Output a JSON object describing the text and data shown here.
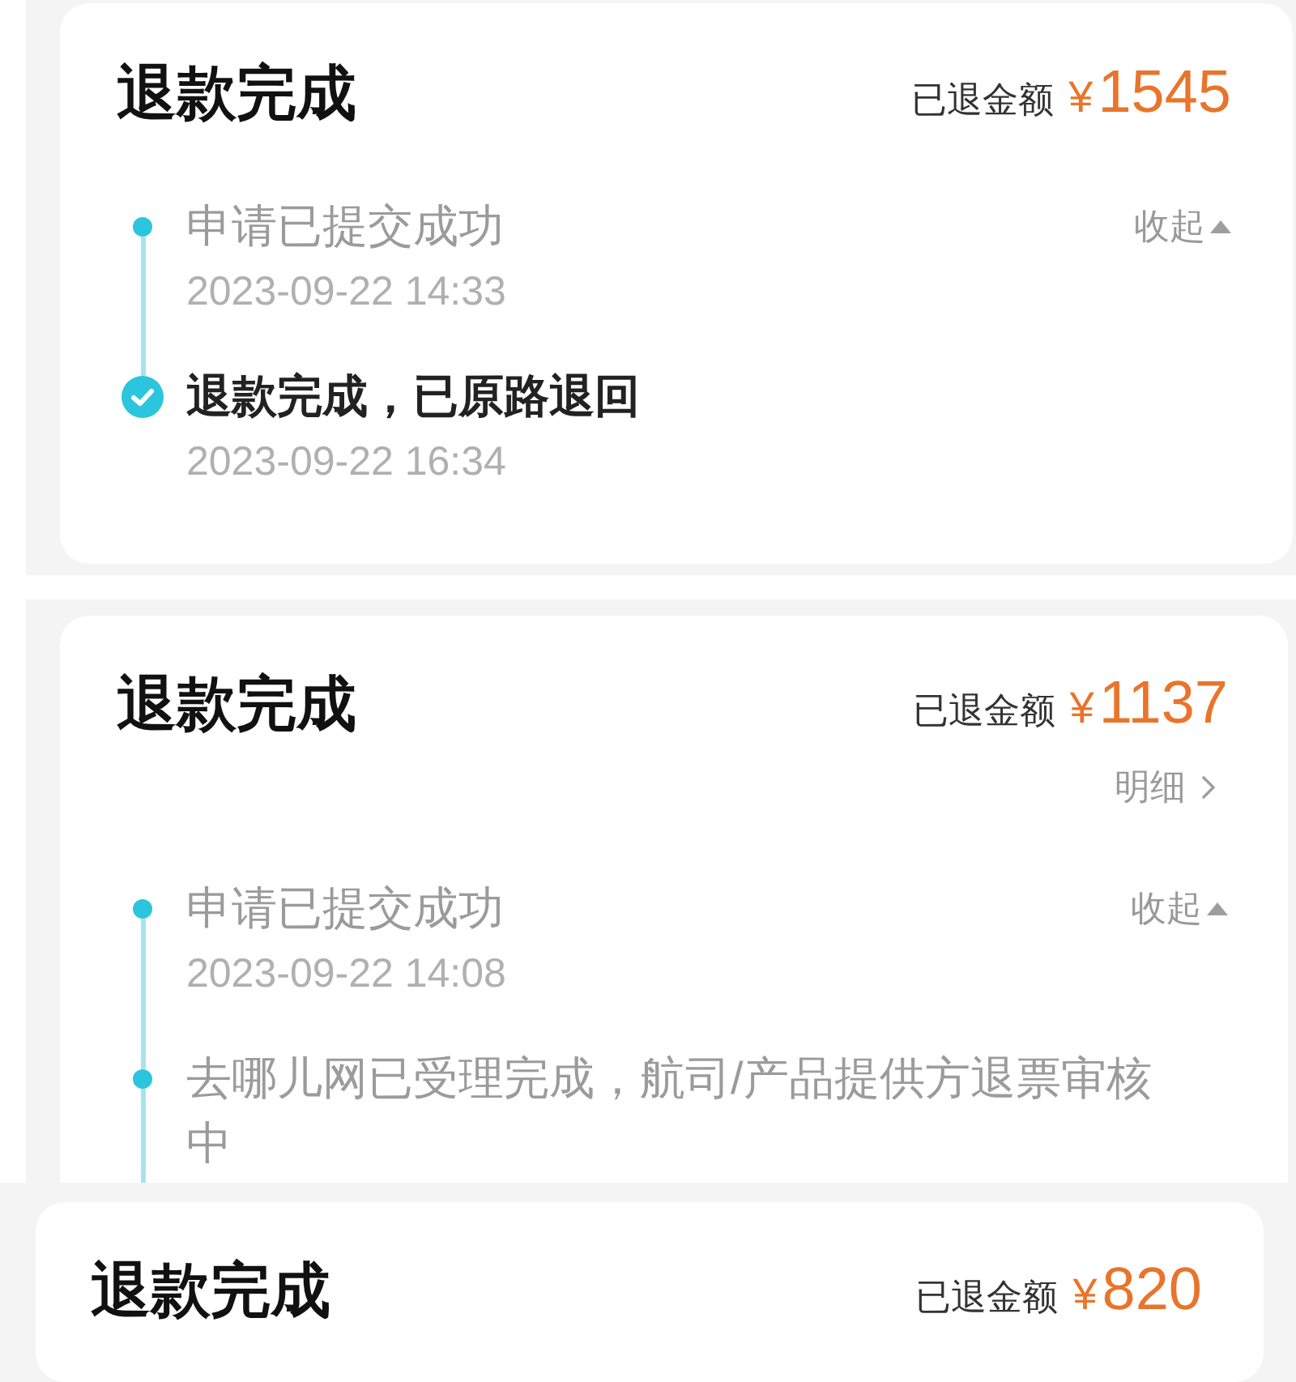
{
  "cards": [
    {
      "title": "退款完成",
      "amount_label": "已退金额",
      "currency": "¥",
      "amount": "1545",
      "collapse_label": "收起",
      "timeline": [
        {
          "kind": "dot",
          "text": "申请已提交成功",
          "time": "2023-09-22 14:33"
        },
        {
          "kind": "check",
          "text": "退款完成，已原路退回",
          "time": "2023-09-22 16:34"
        }
      ]
    },
    {
      "title": "退款完成",
      "amount_label": "已退金额",
      "currency": "¥",
      "amount": "1137",
      "detail_label": "明细",
      "collapse_label": "收起",
      "timeline": [
        {
          "kind": "dot",
          "text": "申请已提交成功",
          "time": "2023-09-22 14:08"
        },
        {
          "kind": "dot",
          "text": "去哪儿网已受理完成，航司/产品提供方退票审核中"
        }
      ]
    },
    {
      "title": "退款完成",
      "amount_label": "已退金额",
      "currency": "¥",
      "amount": "820"
    }
  ]
}
